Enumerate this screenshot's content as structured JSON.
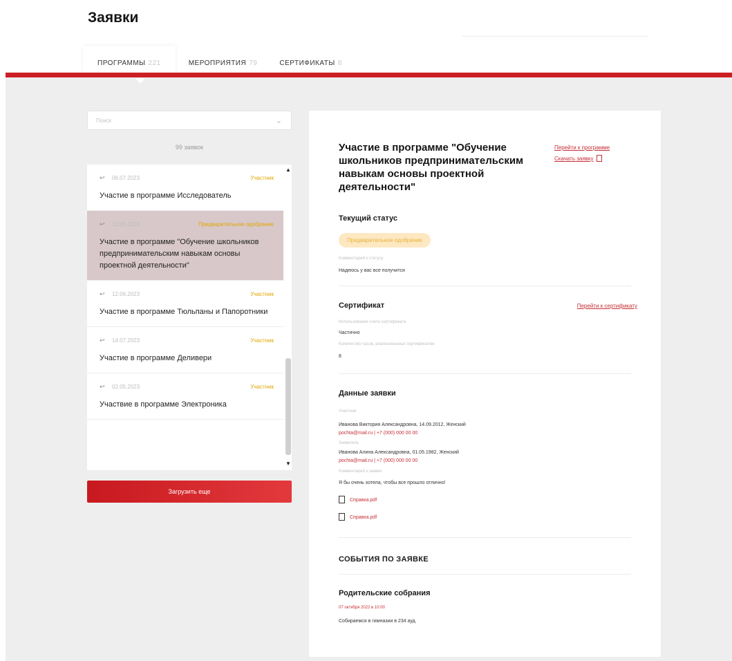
{
  "page": {
    "title": "Заявки"
  },
  "tabs": [
    {
      "label": "ПРОГРАММЫ",
      "count": "221"
    },
    {
      "label": "МЕРОПРИЯТИЯ",
      "count": "79"
    },
    {
      "label": "СЕРТИФИКАТЫ",
      "count": "8"
    }
  ],
  "sidebar": {
    "search_placeholder": "Поиск",
    "count_label": "99 заявок",
    "load_more": "Загрузить еще",
    "items": [
      {
        "date": "06.07.2023",
        "status": "Участник",
        "title": "Участие в программе Исследователь"
      },
      {
        "date": "12.06.2023",
        "status": "Предварительное одобрение",
        "title": "Участие в программе \"Обучение школьников предпринимательским навыкам основы проектной деятельности\""
      },
      {
        "date": "12.06.2023",
        "status": "Участник",
        "title": "Участие в программе Тюльпаны и Папоротники"
      },
      {
        "date": "14.07.2023",
        "status": "Участник",
        "title": "Участие в программе Деливери"
      },
      {
        "date": "02.05.2023",
        "status": "Участник",
        "title": "Участвие в программе Электроника"
      }
    ]
  },
  "detail": {
    "title": "Участие в программе \"Обучение школьников предпринимательским навыкам основы проектной деятельности\"",
    "link_program": "Перейти к программе",
    "link_download": "Скачать заявку",
    "status_section": "Текущий статус",
    "status_value": "Предварительное одобрение",
    "status_comment_label": "Комментарий к статусу",
    "status_comment": "Надеюсь у вас все получится",
    "cert_section": "Сертификат",
    "cert_link": "Перейти к сертификату",
    "cert_usage_label": "Использование счета сертификата",
    "cert_usage": "Частично",
    "cert_hours_label": "Количество часов, реализованных сертификатом",
    "cert_hours": "8",
    "app_section": "Данные заявки",
    "participant_label": "Участник",
    "participant": "Иванова Виктория Александровна, 14.09.2012, Женский",
    "participant_contacts": "pochta@mail.ru | +7 (000) 000 00 00",
    "applicant_label": "Заявитель",
    "applicant": "Иванова Алина Александровна, 01.05.1982, Женский",
    "applicant_contacts": "pochta@mail.ru | +7 (000) 000 00 00",
    "comment_label": "Комментарий к заявке",
    "comment": "Я бы очень хотела, чтобы все прошло отлично!",
    "files": [
      "Справка.pdf",
      "Справка.pdf"
    ],
    "events_section": "СОБЫТИЯ ПО ЗАЯВКЕ",
    "event_title": "Родительские собрания",
    "event_date": "07 октября 2022 в 10:00",
    "event_text": "Собираемся в гимназии в 234 ауд."
  },
  "colors": {
    "accent": "#cc1f24",
    "status_warn": "#e1a600",
    "active_item_bg": "#d8c8c9"
  }
}
